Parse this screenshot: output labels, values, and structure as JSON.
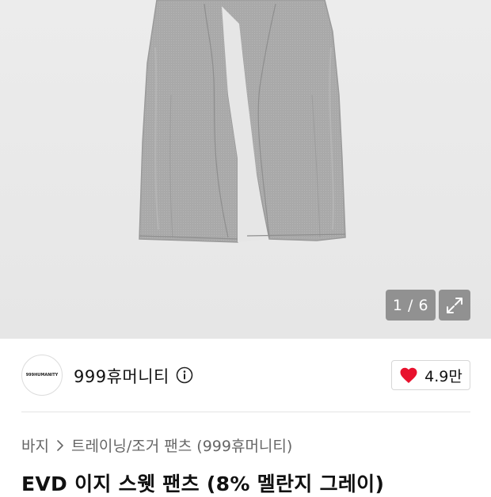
{
  "gallery": {
    "page_indicator": "1 / 6",
    "expand_icon": "expand-icon"
  },
  "brand": {
    "logo_text": "999HUMANITY",
    "name": "999휴머니티",
    "info_icon": "info-icon"
  },
  "like": {
    "icon": "heart-icon",
    "count": "4.9만",
    "color": "#e8112d"
  },
  "breadcrumb": {
    "category": "바지",
    "separator_icon": "chevron-right-icon",
    "subcategory": "트레이닝/조거 팬츠 (999휴머니티)"
  },
  "product": {
    "title": "EVD 이지 스웻 팬츠 (8% 멜란지 그레이)"
  }
}
